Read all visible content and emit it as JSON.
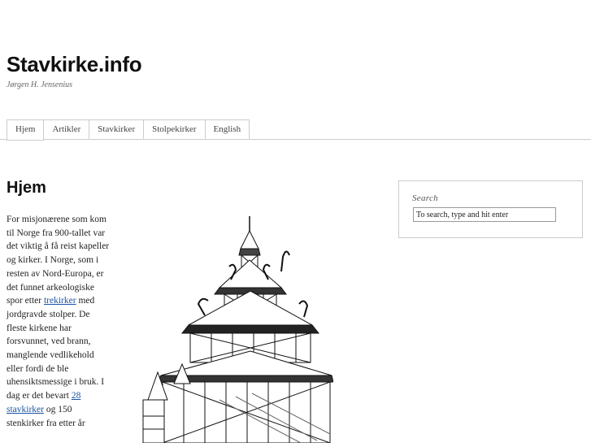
{
  "site": {
    "title": "Stavkirke.info",
    "description": "Jørgen H. Jensenius"
  },
  "nav": {
    "items": [
      {
        "label": "Hjem",
        "active": true
      },
      {
        "label": "Artikler"
      },
      {
        "label": "Stavkirker"
      },
      {
        "label": "Stolpekirker"
      },
      {
        "label": "English"
      }
    ]
  },
  "main": {
    "title": "Hjem",
    "p1": "For misjonærene som kom til Norge fra 900-tallet var det viktig å få reist kapeller og kirker. I Norge, som i resten av Nord-Europa, er det funnet arkeologiske spor etter ",
    "link1": "trekirker",
    "p2": " med jordgravde stolper. De fleste kirkene har forsvunnet, ved brann, manglende vedlikehold eller fordi de ble uhensiktsmessige i bruk. I dag er det bevart ",
    "link2": "28 stavkirker",
    "p3": " og 150 stenkirker fra etter år",
    "illustration_icon": "stave-church-drawing"
  },
  "sidebar": {
    "search_label": "Search",
    "search_placeholder": "To search, type and hit enter"
  }
}
